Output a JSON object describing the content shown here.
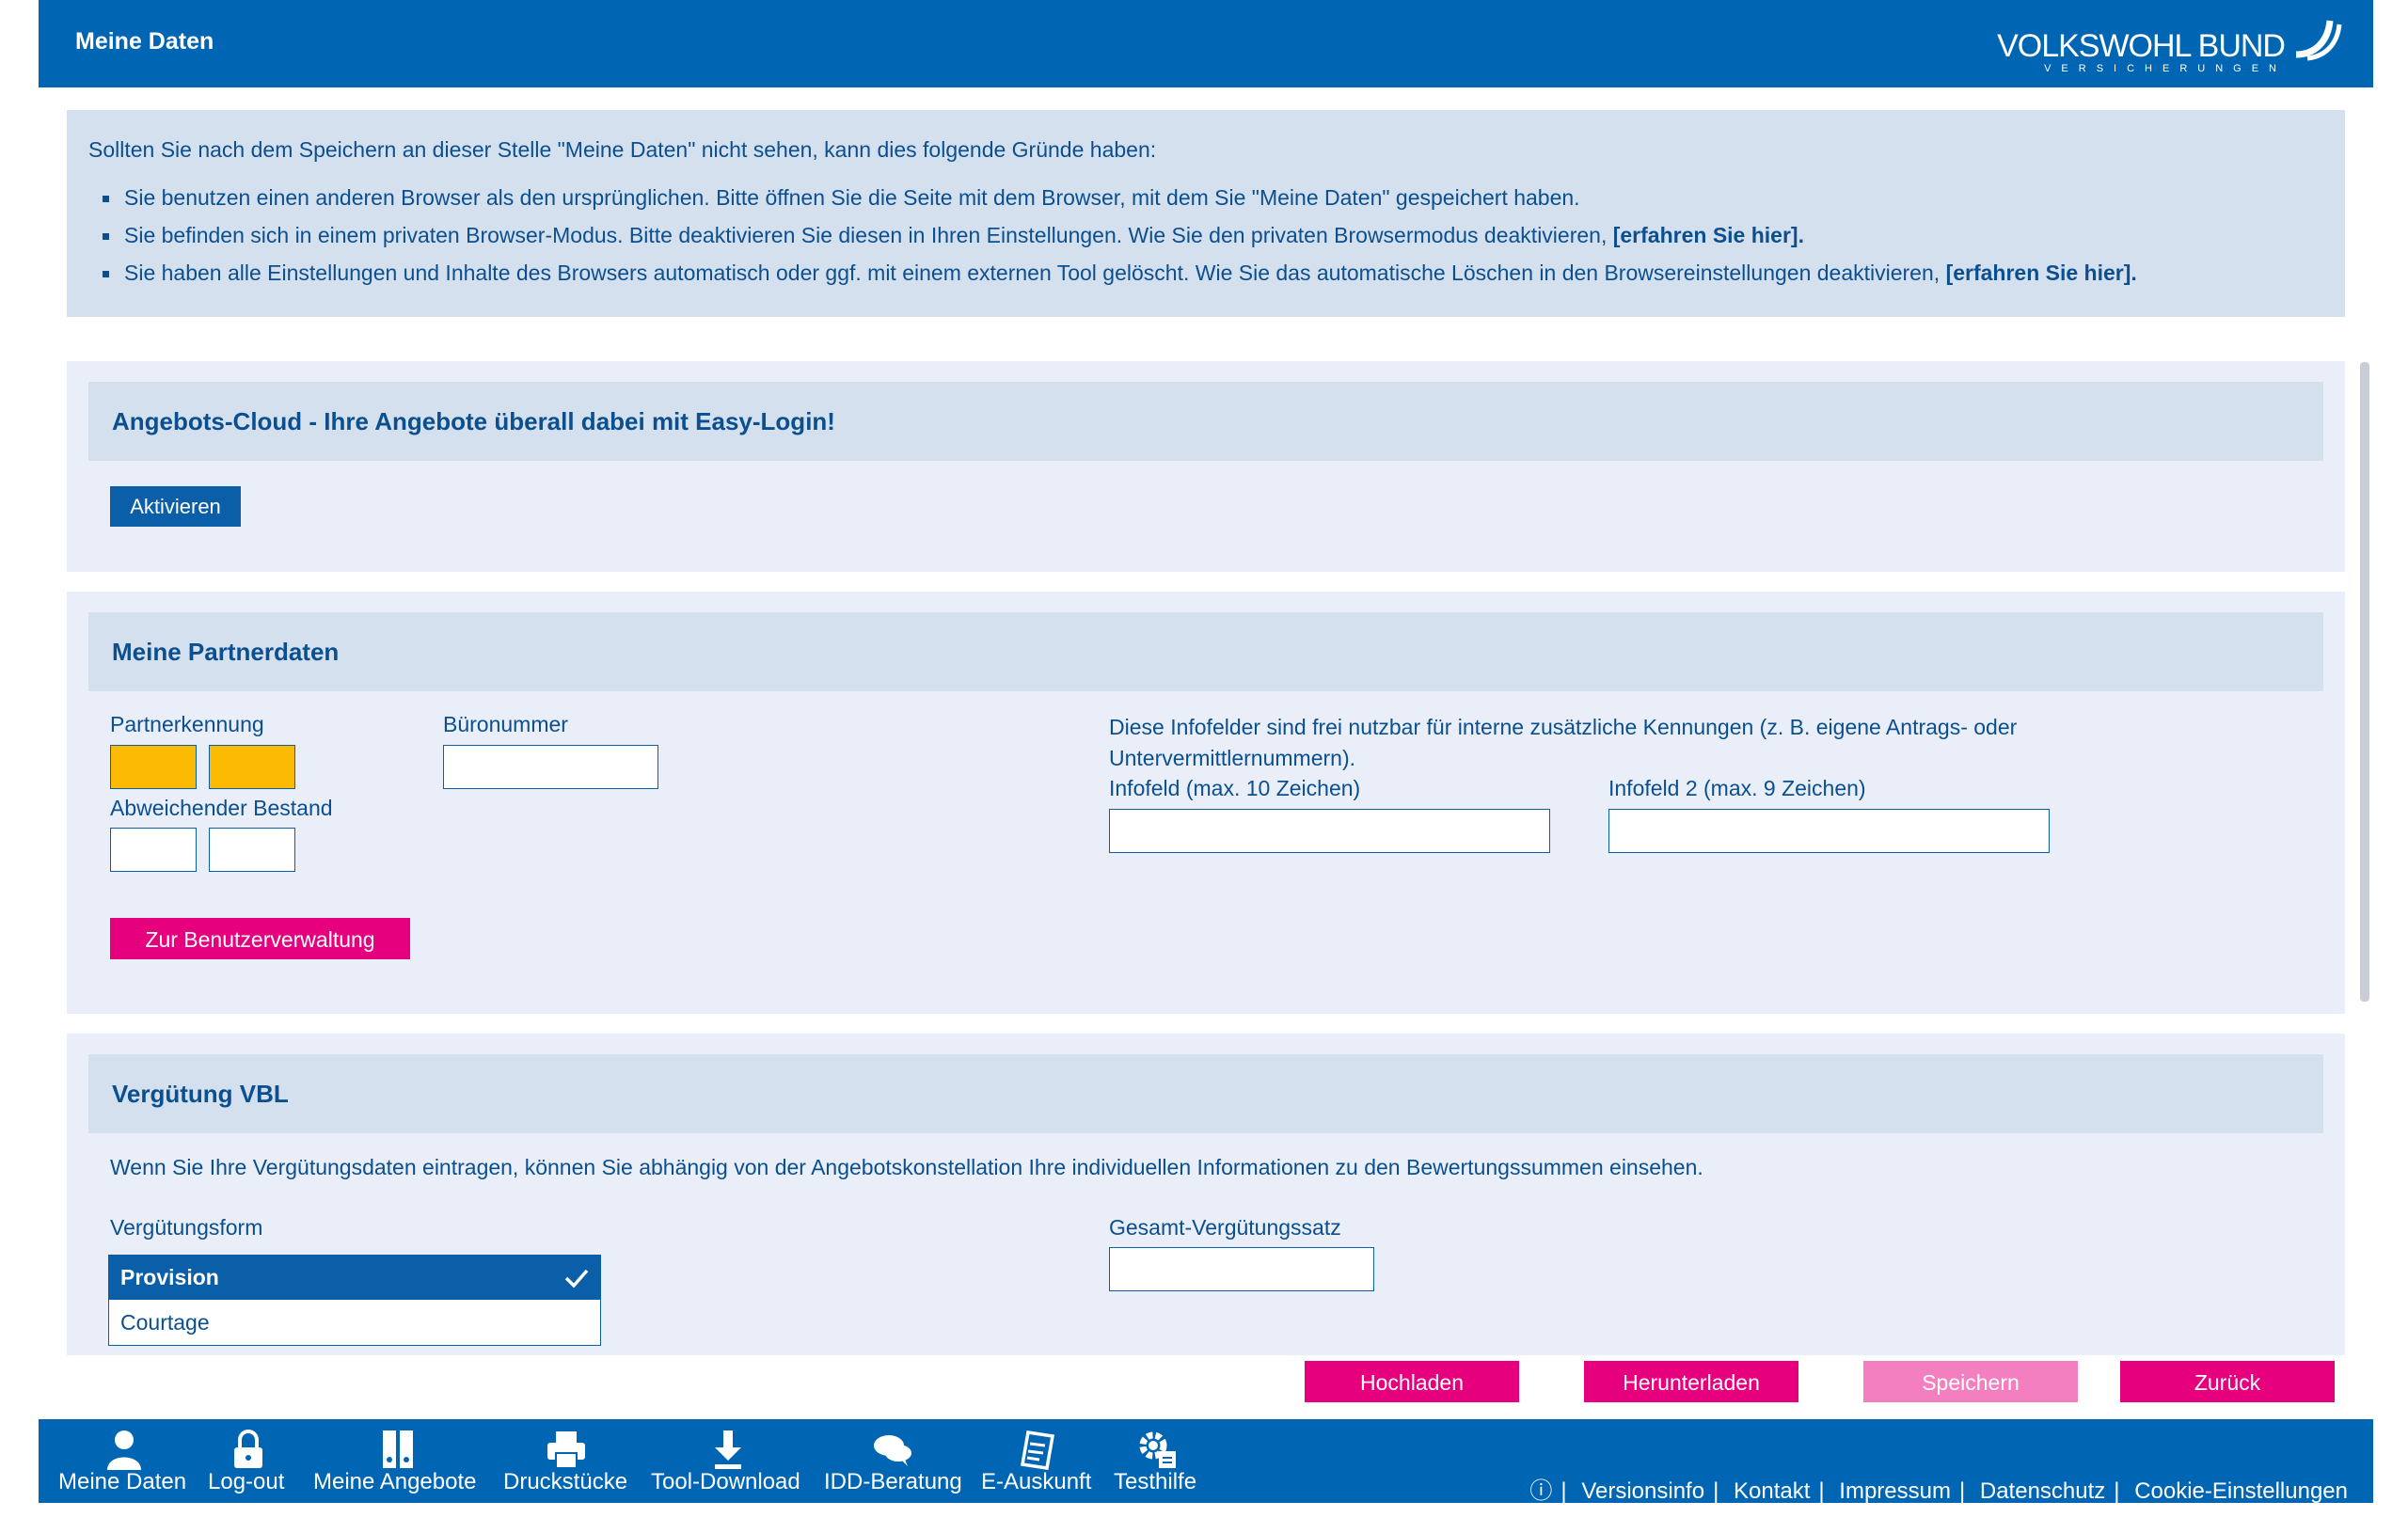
{
  "header": {
    "title": "Meine Daten",
    "logo_main": "VOLKSWOHL BUND",
    "logo_sub": "VERSICHERUNGEN"
  },
  "notice": {
    "intro": "Sollten Sie nach dem Speichern an dieser Stelle \"Meine Daten\" nicht sehen, kann dies folgende Gründe haben:",
    "item1": "Sie benutzen einen anderen Browser als den ursprünglichen. Bitte öffnen Sie die Seite mit dem Browser, mit dem Sie \"Meine Daten\" gespeichert haben.",
    "item2": "Sie befinden sich in einem privaten Browser-Modus. Bitte deaktivieren Sie diesen in Ihren Einstellungen. Wie Sie den privaten Browsermodus deaktivieren,",
    "item3": "Sie haben alle Einstellungen und Inhalte des Browsers automatisch oder ggf. mit einem externen Tool gelöscht. Wie Sie das automatische Löschen in den Browsereinstellungen deaktivieren,",
    "link": "[erfahren Sie hier]."
  },
  "cloud": {
    "title": "Angebots-Cloud - Ihre Angebote überall dabei mit Easy-Login!",
    "button": "Aktivieren"
  },
  "partner": {
    "title": "Meine Partnerdaten",
    "partnerkennung_label": "Partnerkennung",
    "bueronummer_label": "Büronummer",
    "abweichender_label": "Abweichender Bestand",
    "info_text": "Diese Infofelder sind frei nutzbar für interne zusätzliche Kennungen (z. B. eigene Antrags- oder Untervermittlernummern).",
    "infofeld1_label": "Infofeld (max. 10 Zeichen)",
    "infofeld2_label": "Infofeld 2 (max. 9 Zeichen)",
    "button": "Zur Benutzerverwaltung"
  },
  "verguetung": {
    "title": "Vergütung VBL",
    "text": "Wenn Sie Ihre Vergütungsdaten eintragen, können Sie abhängig von der Angebotskonstellation Ihre individuellen Informationen zu den Bewertungssummen einsehen.",
    "form_label": "Vergütungsform",
    "options": [
      "Provision",
      "Courtage"
    ],
    "selected": "Provision",
    "satz_label": "Gesamt-Vergütungssatz"
  },
  "actions": {
    "upload": "Hochladen",
    "download": "Herunterladen",
    "save": "Speichern",
    "back": "Zurück"
  },
  "footer": {
    "nav": [
      "Meine Daten",
      "Log-out",
      "Meine Angebote",
      "Druckstücke",
      "Tool-Download",
      "IDD-Beratung",
      "E-Auskunft",
      "Testhilfe"
    ],
    "info_icon": "ⓘ",
    "links": [
      "Versionsinfo",
      "Kontakt",
      "Impressum",
      "Datenschutz",
      "Cookie-Einstellungen"
    ]
  },
  "colors": {
    "brand_blue": "#0066b3",
    "pink": "#e6007e",
    "pink_disabled": "#f47fc0",
    "yellow": "#fcba03",
    "panel": "#e9eef8"
  }
}
